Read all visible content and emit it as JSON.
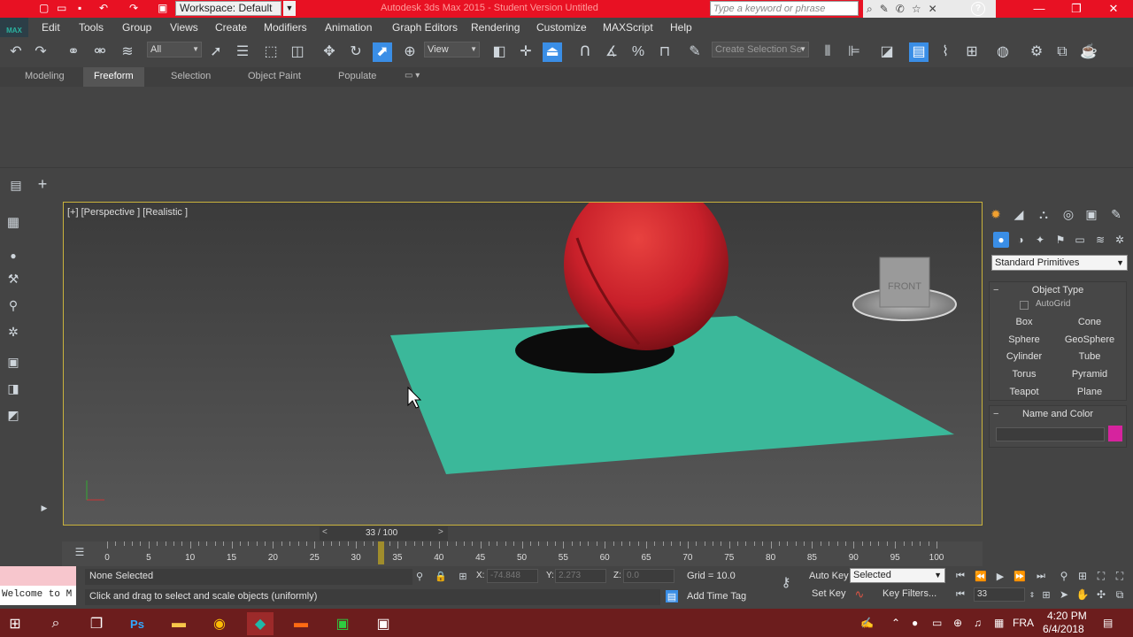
{
  "titlebar": {
    "workspace": "Workspace: Default",
    "title": "Autodesk 3ds Max 2015 - Student Version   Untitled",
    "search_placeholder": "Type a keyword or phrase",
    "help_label": "?"
  },
  "logo": "MAX",
  "menu": [
    "Edit",
    "Tools",
    "Group",
    "Views",
    "Create",
    "Modifiers",
    "Animation",
    "Graph Editors",
    "Rendering",
    "Customize",
    "MAXScript",
    "Help"
  ],
  "toolbar": {
    "filter_value": "All",
    "coord_value": "View",
    "selection_set_placeholder": "Create Selection Se"
  },
  "ribbon_tabs": [
    "Modeling",
    "Freeform",
    "Selection",
    "Object Paint",
    "Populate"
  ],
  "ribbon_active_tab": "Freeform",
  "viewport": {
    "label": "[+] [Perspective ] [Realistic ]",
    "viewcube_label": "FRONT"
  },
  "command_panel": {
    "category": "Standard Primitives",
    "object_type_title": "Object Type",
    "autogrid": "AutoGrid",
    "objects": [
      "Box",
      "Cone",
      "Sphere",
      "GeoSphere",
      "Cylinder",
      "Tube",
      "Torus",
      "Pyramid",
      "Teapot",
      "Plane"
    ],
    "name_color_title": "Name and Color",
    "object_color": "#d6239e"
  },
  "time": {
    "frame_display": "33 / 100",
    "current_frame": 33,
    "ticks": [
      "0",
      "5",
      "10",
      "15",
      "20",
      "25",
      "30",
      "35",
      "40",
      "45",
      "50",
      "55",
      "60",
      "65",
      "70",
      "75",
      "80",
      "85",
      "90",
      "95",
      "100"
    ]
  },
  "status": {
    "selection": "None Selected",
    "prompt": "Click and drag to select and scale objects (uniformly)",
    "maxscript_text": "Welcome to M",
    "x_label": "X:",
    "x_value": "-74.848",
    "y_label": "Y:",
    "y_value": "2.273",
    "z_label": "Z:",
    "z_value": "0.0",
    "grid": "Grid = 10.0",
    "add_time_tag": "Add Time Tag",
    "auto_key": "Auto Key",
    "set_key": "Set Key",
    "key_mode": "Selected",
    "key_filters": "Key Filters...",
    "frame_field": "33"
  },
  "taskbar": {
    "language": "FRA",
    "time": "4:20 PM",
    "date": "6/4/2018"
  },
  "colors": {
    "title_red": "#e81123",
    "plane_teal": "#3bb89a",
    "apple_red": "#c8202a",
    "active_blue": "#3a8ee6"
  }
}
